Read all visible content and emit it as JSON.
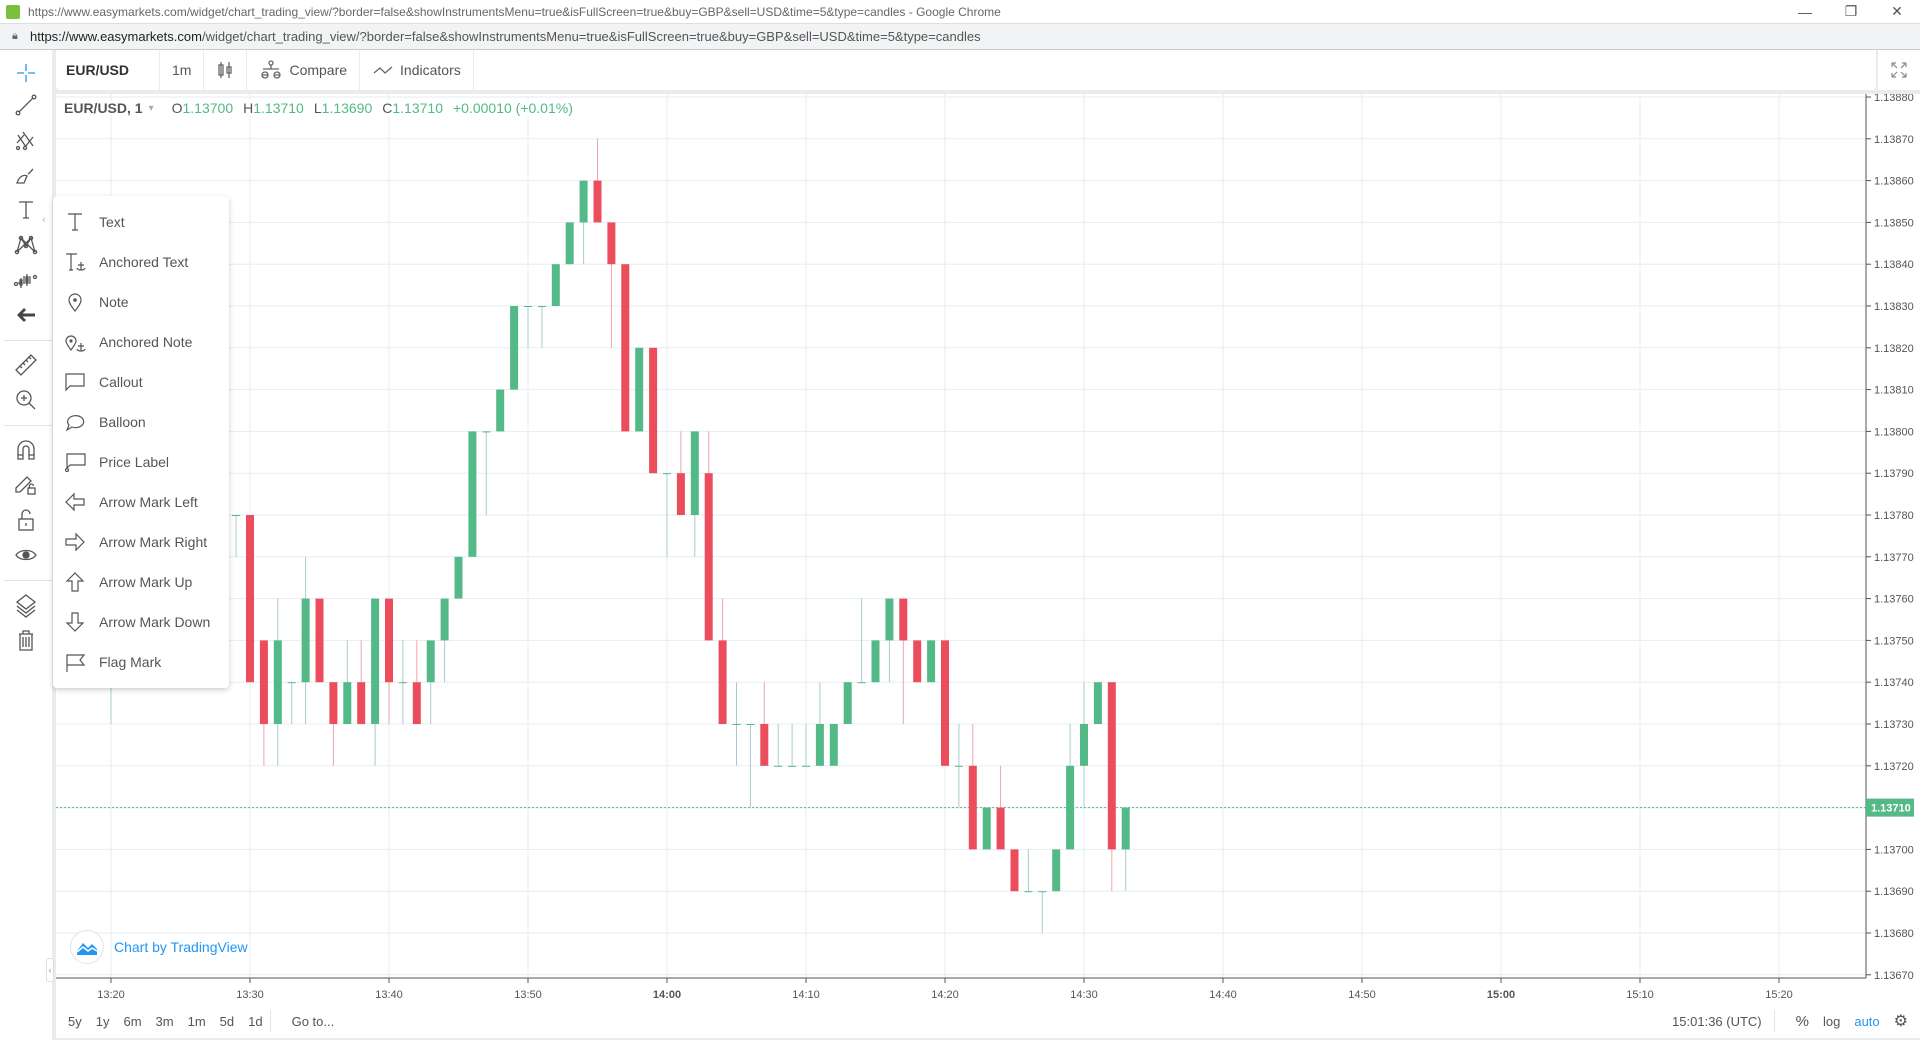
{
  "browser": {
    "title": "https://www.easymarkets.com/widget/chart_trading_view/?border=false&showInstrumentsMenu=true&isFullScreen=true&buy=GBP&sell=USD&time=5&type=candles - Google Chrome",
    "url_domain": "https://www.easymarkets.com",
    "url_path": "/widget/chart_trading_view/?border=false&showInstrumentsMenu=true&isFullScreen=true&buy=GBP&sell=USD&time=5&type=candles",
    "minimize": "—",
    "restore": "❐",
    "close": "✕"
  },
  "toolbar": {
    "symbol": "EUR/USD",
    "interval": "1m",
    "compare": "Compare",
    "indicators": "Indicators"
  },
  "legend": {
    "symbol": "EUR/USD, 1",
    "open_label": "O",
    "open": "1.13700",
    "high_label": "H",
    "high": "1.13710",
    "low_label": "L",
    "low": "1.13690",
    "close_label": "C",
    "close": "1.13710",
    "change": "+0.00010 (+0.01%)"
  },
  "left_tools": [
    {
      "name": "crosshair-icon",
      "active": true
    },
    {
      "name": "trend-line-icon"
    },
    {
      "name": "pitchfork-icon"
    },
    {
      "name": "brush-icon"
    },
    {
      "name": "text-icon"
    },
    {
      "name": "pattern-icon"
    },
    {
      "name": "prediction-icon"
    },
    {
      "name": "back-arrow-icon"
    },
    {
      "name": "ruler-icon"
    },
    {
      "name": "zoom-in-icon"
    },
    {
      "name": "magnet-icon"
    },
    {
      "name": "lock-drawing-icon"
    },
    {
      "name": "unlock-icon"
    },
    {
      "name": "eye-icon"
    },
    {
      "name": "layers-icon"
    },
    {
      "name": "trash-icon"
    }
  ],
  "text_menu": {
    "items": [
      {
        "label": "Text",
        "icon": "text-icon"
      },
      {
        "label": "Anchored Text",
        "icon": "anchored-text-icon"
      },
      {
        "label": "Note",
        "icon": "note-icon"
      },
      {
        "label": "Anchored Note",
        "icon": "anchored-note-icon"
      },
      {
        "label": "Callout",
        "icon": "callout-icon"
      },
      {
        "label": "Balloon",
        "icon": "balloon-icon"
      },
      {
        "label": "Price Label",
        "icon": "price-label-icon"
      },
      {
        "label": "Arrow Mark Left",
        "icon": "arrow-left-icon"
      },
      {
        "label": "Arrow Mark Right",
        "icon": "arrow-right-icon"
      },
      {
        "label": "Arrow Mark Up",
        "icon": "arrow-up-icon"
      },
      {
        "label": "Arrow Mark Down",
        "icon": "arrow-down-icon"
      },
      {
        "label": "Flag Mark",
        "icon": "flag-icon"
      }
    ]
  },
  "branding": {
    "label": "Chart by TradingView"
  },
  "bottom": {
    "ranges": [
      "5y",
      "1y",
      "6m",
      "3m",
      "1m",
      "5d",
      "1d"
    ],
    "goto": "Go to...",
    "clock": "15:01:36 (UTC)",
    "percent": "%",
    "log": "log",
    "auto": "auto"
  },
  "colors": {
    "up": "#53b987",
    "down": "#eb4d5c",
    "accent": "#2196f3"
  },
  "chart_data": {
    "type": "candlestick",
    "symbol": "EUR/USD",
    "interval": "1m",
    "y_ticks": [
      "1.13880",
      "1.13870",
      "1.13860",
      "1.13850",
      "1.13840",
      "1.13830",
      "1.13820",
      "1.13810",
      "1.13800",
      "1.13790",
      "1.13780",
      "1.13770",
      "1.13760",
      "1.13750",
      "1.13740",
      "1.13730",
      "1.13720",
      "1.13710",
      "1.13700",
      "1.13690",
      "1.13680",
      "1.13670"
    ],
    "ylim": [
      1.13668,
      1.13882
    ],
    "x_ticks": [
      "13:20",
      "13:30",
      "13:40",
      "13:50",
      "14:00",
      "14:10",
      "14:20",
      "14:30",
      "14:40",
      "14:50",
      "15:00",
      "15:10",
      "15:20"
    ],
    "x_range_minutes": [
      "13:16",
      "15:26"
    ],
    "last_price": "1.13710",
    "candles": [
      {
        "t": "13:20",
        "o": 1.1379,
        "h": 1.1379,
        "l": 1.1373,
        "c": 1.1379
      },
      {
        "t": "13:29",
        "o": 1.1378,
        "h": 1.1378,
        "l": 1.1377,
        "c": 1.1378
      },
      {
        "t": "13:30",
        "o": 1.1378,
        "h": 1.1378,
        "l": 1.1374,
        "c": 1.1374
      },
      {
        "t": "13:31",
        "o": 1.1375,
        "h": 1.1375,
        "l": 1.1372,
        "c": 1.1373
      },
      {
        "t": "13:32",
        "o": 1.1373,
        "h": 1.1376,
        "l": 1.1372,
        "c": 1.1375
      },
      {
        "t": "13:33",
        "o": 1.1374,
        "h": 1.1374,
        "l": 1.1373,
        "c": 1.1374
      },
      {
        "t": "13:34",
        "o": 1.1374,
        "h": 1.1377,
        "l": 1.1373,
        "c": 1.1376
      },
      {
        "t": "13:35",
        "o": 1.1376,
        "h": 1.1376,
        "l": 1.1374,
        "c": 1.1374
      },
      {
        "t": "13:36",
        "o": 1.1374,
        "h": 1.1374,
        "l": 1.1372,
        "c": 1.1373
      },
      {
        "t": "13:37",
        "o": 1.1373,
        "h": 1.1375,
        "l": 1.1373,
        "c": 1.1374
      },
      {
        "t": "13:38",
        "o": 1.1374,
        "h": 1.1375,
        "l": 1.1373,
        "c": 1.1373
      },
      {
        "t": "13:39",
        "o": 1.1373,
        "h": 1.1376,
        "l": 1.1372,
        "c": 1.1376
      },
      {
        "t": "13:40",
        "o": 1.1376,
        "h": 1.1376,
        "l": 1.1373,
        "c": 1.1374
      },
      {
        "t": "13:41",
        "o": 1.1374,
        "h": 1.1375,
        "l": 1.1373,
        "c": 1.1374
      },
      {
        "t": "13:42",
        "o": 1.1374,
        "h": 1.1375,
        "l": 1.1373,
        "c": 1.1373
      },
      {
        "t": "13:43",
        "o": 1.1374,
        "h": 1.1375,
        "l": 1.1373,
        "c": 1.1375
      },
      {
        "t": "13:44",
        "o": 1.1375,
        "h": 1.1376,
        "l": 1.1374,
        "c": 1.1376
      },
      {
        "t": "13:45",
        "o": 1.1376,
        "h": 1.1377,
        "l": 1.1376,
        "c": 1.1377
      },
      {
        "t": "13:46",
        "o": 1.1377,
        "h": 1.138,
        "l": 1.1377,
        "c": 1.138
      },
      {
        "t": "13:47",
        "o": 1.138,
        "h": 1.138,
        "l": 1.1378,
        "c": 1.138
      },
      {
        "t": "13:48",
        "o": 1.138,
        "h": 1.1381,
        "l": 1.138,
        "c": 1.1381
      },
      {
        "t": "13:49",
        "o": 1.1381,
        "h": 1.1383,
        "l": 1.1381,
        "c": 1.1383
      },
      {
        "t": "13:50",
        "o": 1.1383,
        "h": 1.1383,
        "l": 1.1382,
        "c": 1.1383
      },
      {
        "t": "13:51",
        "o": 1.1383,
        "h": 1.1383,
        "l": 1.1382,
        "c": 1.1383
      },
      {
        "t": "13:52",
        "o": 1.1383,
        "h": 1.1384,
        "l": 1.1383,
        "c": 1.1384
      },
      {
        "t": "13:53",
        "o": 1.1384,
        "h": 1.1385,
        "l": 1.1384,
        "c": 1.1385
      },
      {
        "t": "13:54",
        "o": 1.1385,
        "h": 1.1386,
        "l": 1.1384,
        "c": 1.1386
      },
      {
        "t": "13:55",
        "o": 1.1386,
        "h": 1.1387,
        "l": 1.1385,
        "c": 1.1385
      },
      {
        "t": "13:56",
        "o": 1.1385,
        "h": 1.1385,
        "l": 1.1382,
        "c": 1.1384
      },
      {
        "t": "13:57",
        "o": 1.1384,
        "h": 1.1384,
        "l": 1.138,
        "c": 1.138
      },
      {
        "t": "13:58",
        "o": 1.138,
        "h": 1.1382,
        "l": 1.138,
        "c": 1.1382
      },
      {
        "t": "13:59",
        "o": 1.1382,
        "h": 1.1382,
        "l": 1.1379,
        "c": 1.1379
      },
      {
        "t": "14:00",
        "o": 1.1379,
        "h": 1.1379,
        "l": 1.1377,
        "c": 1.1379
      },
      {
        "t": "14:01",
        "o": 1.1379,
        "h": 1.138,
        "l": 1.1378,
        "c": 1.1378
      },
      {
        "t": "14:02",
        "o": 1.1378,
        "h": 1.138,
        "l": 1.1377,
        "c": 1.138
      },
      {
        "t": "14:03",
        "o": 1.1379,
        "h": 1.138,
        "l": 1.1375,
        "c": 1.1375
      },
      {
        "t": "14:04",
        "o": 1.1375,
        "h": 1.1376,
        "l": 1.1373,
        "c": 1.1373
      },
      {
        "t": "14:05",
        "o": 1.1373,
        "h": 1.1374,
        "l": 1.1372,
        "c": 1.1373
      },
      {
        "t": "14:06",
        "o": 1.1373,
        "h": 1.1373,
        "l": 1.1371,
        "c": 1.1373
      },
      {
        "t": "14:07",
        "o": 1.1373,
        "h": 1.1374,
        "l": 1.1372,
        "c": 1.1372
      },
      {
        "t": "14:08",
        "o": 1.1372,
        "h": 1.1373,
        "l": 1.1372,
        "c": 1.1372
      },
      {
        "t": "14:09",
        "o": 1.1372,
        "h": 1.1373,
        "l": 1.1372,
        "c": 1.1372
      },
      {
        "t": "14:10",
        "o": 1.1372,
        "h": 1.1373,
        "l": 1.1372,
        "c": 1.1372
      },
      {
        "t": "14:11",
        "o": 1.1372,
        "h": 1.1374,
        "l": 1.1372,
        "c": 1.1373
      },
      {
        "t": "14:12",
        "o": 1.1372,
        "h": 1.1373,
        "l": 1.1372,
        "c": 1.1373
      },
      {
        "t": "14:13",
        "o": 1.1373,
        "h": 1.1374,
        "l": 1.1373,
        "c": 1.1374
      },
      {
        "t": "14:14",
        "o": 1.1374,
        "h": 1.1376,
        "l": 1.1374,
        "c": 1.1374
      },
      {
        "t": "14:15",
        "o": 1.1374,
        "h": 1.1375,
        "l": 1.1374,
        "c": 1.1375
      },
      {
        "t": "14:16",
        "o": 1.1375,
        "h": 1.1376,
        "l": 1.1374,
        "c": 1.1376
      },
      {
        "t": "14:17",
        "o": 1.1376,
        "h": 1.1376,
        "l": 1.1373,
        "c": 1.1375
      },
      {
        "t": "14:18",
        "o": 1.1375,
        "h": 1.1375,
        "l": 1.1374,
        "c": 1.1374
      },
      {
        "t": "14:19",
        "o": 1.1374,
        "h": 1.1375,
        "l": 1.1374,
        "c": 1.1375
      },
      {
        "t": "14:20",
        "o": 1.1375,
        "h": 1.1375,
        "l": 1.1372,
        "c": 1.1372
      },
      {
        "t": "14:21",
        "o": 1.1372,
        "h": 1.1373,
        "l": 1.1371,
        "c": 1.1372
      },
      {
        "t": "14:22",
        "o": 1.1372,
        "h": 1.1373,
        "l": 1.137,
        "c": 1.137
      },
      {
        "t": "14:23",
        "o": 1.137,
        "h": 1.1371,
        "l": 1.137,
        "c": 1.1371
      },
      {
        "t": "14:24",
        "o": 1.1371,
        "h": 1.1372,
        "l": 1.137,
        "c": 1.137
      },
      {
        "t": "14:25",
        "o": 1.137,
        "h": 1.137,
        "l": 1.1369,
        "c": 1.1369
      },
      {
        "t": "14:26",
        "o": 1.1369,
        "h": 1.137,
        "l": 1.1369,
        "c": 1.1369
      },
      {
        "t": "14:27",
        "o": 1.1369,
        "h": 1.1369,
        "l": 1.1368,
        "c": 1.1369
      },
      {
        "t": "14:28",
        "o": 1.1369,
        "h": 1.137,
        "l": 1.1369,
        "c": 1.137
      },
      {
        "t": "14:29",
        "o": 1.137,
        "h": 1.1373,
        "l": 1.137,
        "c": 1.1372
      },
      {
        "t": "14:30",
        "o": 1.1372,
        "h": 1.1374,
        "l": 1.1371,
        "c": 1.1373
      },
      {
        "t": "14:31",
        "o": 1.1373,
        "h": 1.1374,
        "l": 1.1373,
        "c": 1.1374
      },
      {
        "t": "14:32",
        "o": 1.1374,
        "h": 1.1374,
        "l": 1.1369,
        "c": 1.137
      },
      {
        "t": "14:33",
        "o": 1.137,
        "h": 1.1371,
        "l": 1.1369,
        "c": 1.1371
      }
    ]
  }
}
